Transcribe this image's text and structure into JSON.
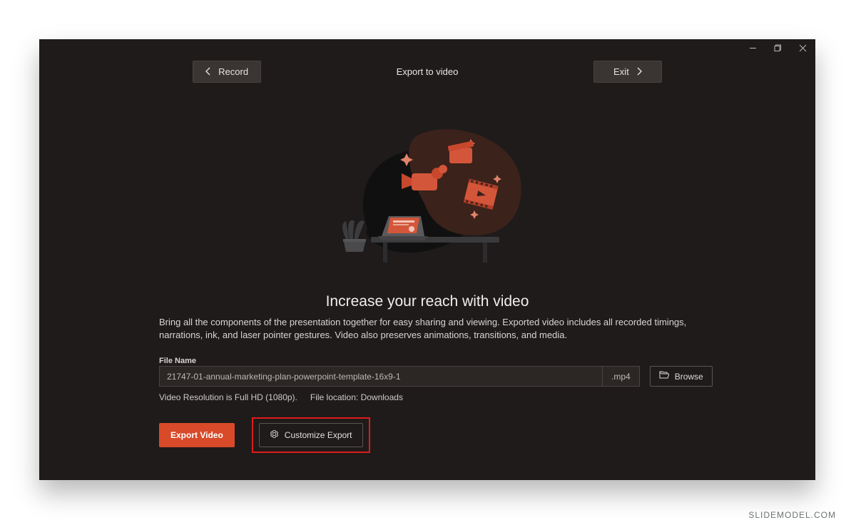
{
  "window": {
    "controls": {
      "minimize": "minimize",
      "restore": "restore",
      "close": "close"
    }
  },
  "topbar": {
    "back_label": "Record",
    "title": "Export to video",
    "exit_label": "Exit"
  },
  "content": {
    "headline": "Increase your reach with video",
    "description": "Bring all the components of the presentation together for easy sharing and viewing. Exported video includes all recorded timings, narrations, ink, and laser pointer gestures. Video also preserves animations, transitions, and media."
  },
  "file": {
    "label": "File Name",
    "value": "21747-01-annual-marketing-plan-powerpoint-template-16x9-1",
    "extension": ".mp4",
    "browse_label": "Browse"
  },
  "meta": {
    "resolution": "Video Resolution is Full HD (1080p).",
    "location": "File location: Downloads"
  },
  "actions": {
    "export_label": "Export Video",
    "customize_label": "Customize Export"
  },
  "branding": {
    "watermark": "SLIDEMODEL.COM"
  },
  "colors": {
    "accent": "#d84a2a",
    "bg": "#1f1b1b",
    "highlight": "#e01b1b"
  }
}
